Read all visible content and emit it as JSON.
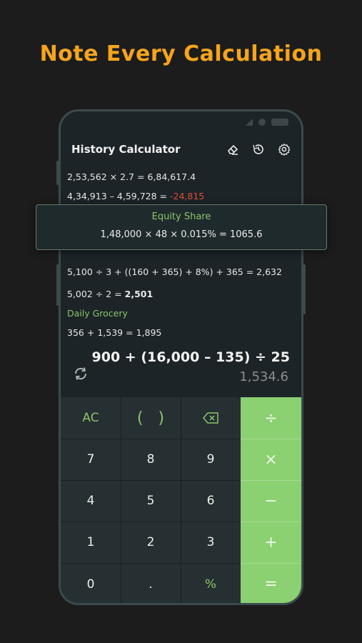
{
  "headline": "Note Every Calculation",
  "app": {
    "title": "History Calculator",
    "icons": [
      "eraser-icon",
      "history-icon",
      "settings-icon"
    ]
  },
  "history": [
    {
      "a": "2,53,562",
      "op": "×",
      "b": "2.7",
      "eq": "=",
      "res": "6,84,617.4"
    },
    {
      "a": "4,34,913",
      "op": "–",
      "b": "4,59,728",
      "eq": "=",
      "res": "-24,815"
    },
    {
      "expr": "5,100 ÷ 3 + ((160 + 365) + 8%) + 365 = 2,632"
    },
    {
      "a": "5,002",
      "op": "÷",
      "b": "2",
      "eq": "=",
      "res": "2,501"
    },
    {
      "label": "Daily Grocery"
    },
    {
      "a": "356",
      "op": "+",
      "b": "1,539",
      "eq": "=",
      "res": "1,895"
    }
  ],
  "highlight_card": {
    "title": "Equity Share",
    "expr": "1,48,000 × 48 × 0.015% = 1065.6"
  },
  "display": {
    "expression": "900 + (16,000 – 135) ÷ 25",
    "result": "1,534.6"
  },
  "keypad": {
    "rows": [
      [
        "AC",
        "(   )",
        "⌫",
        "÷"
      ],
      [
        "7",
        "8",
        "9",
        "×"
      ],
      [
        "4",
        "5",
        "6",
        "−"
      ],
      [
        "1",
        "2",
        "3",
        "+"
      ],
      [
        "0",
        ".",
        "%",
        "="
      ]
    ]
  },
  "colors": {
    "accent_orange": "#f5a41c",
    "accent_green": "#8bd071",
    "negative_red": "#e04b3a",
    "background": "#1c1c1c",
    "phone_bg": "#1c2427"
  }
}
